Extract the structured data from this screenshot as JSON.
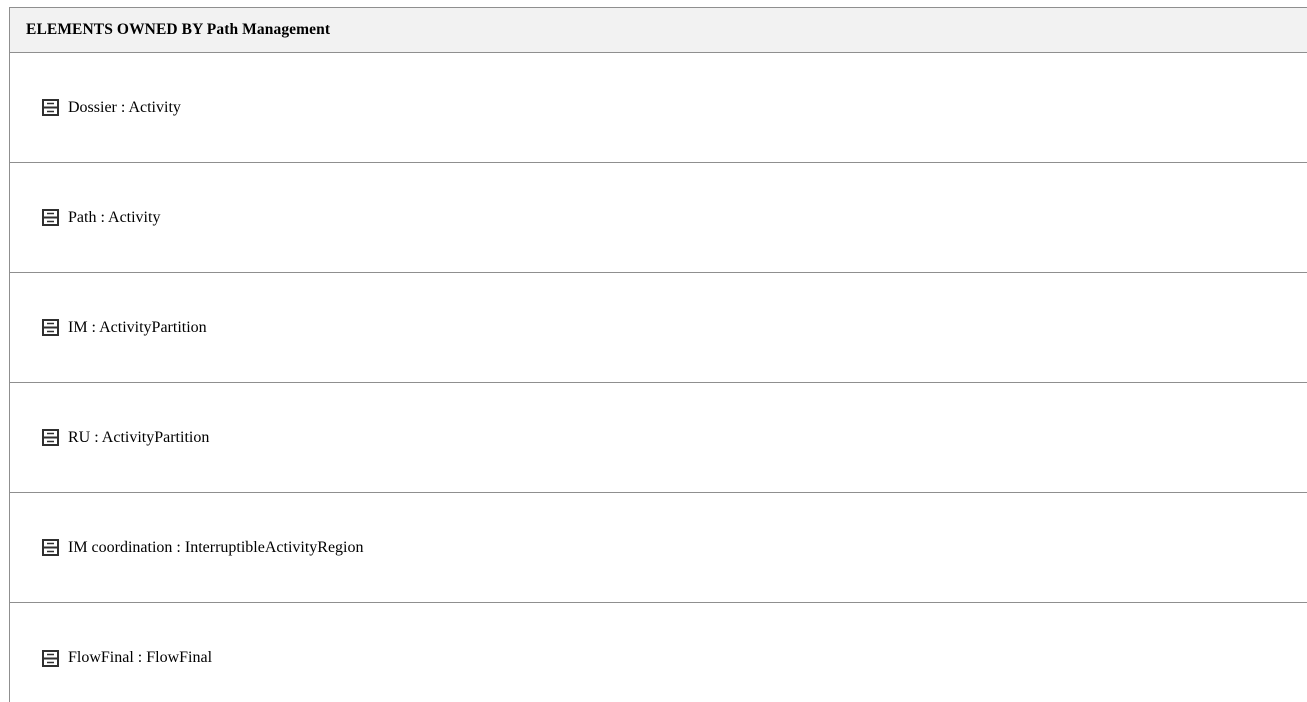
{
  "panel": {
    "header": "ELEMENTS OWNED BY Path Management"
  },
  "elements": [
    {
      "label": "Dossier : Activity",
      "icon": "element-icon"
    },
    {
      "label": "Path : Activity",
      "icon": "element-icon"
    },
    {
      "label": "IM : ActivityPartition",
      "icon": "element-icon"
    },
    {
      "label": "RU : ActivityPartition",
      "icon": "element-icon"
    },
    {
      "label": "IM coordination : InterruptibleActivityRegion",
      "icon": "element-icon"
    },
    {
      "label": "FlowFinal : FlowFinal",
      "icon": "element-icon"
    }
  ]
}
